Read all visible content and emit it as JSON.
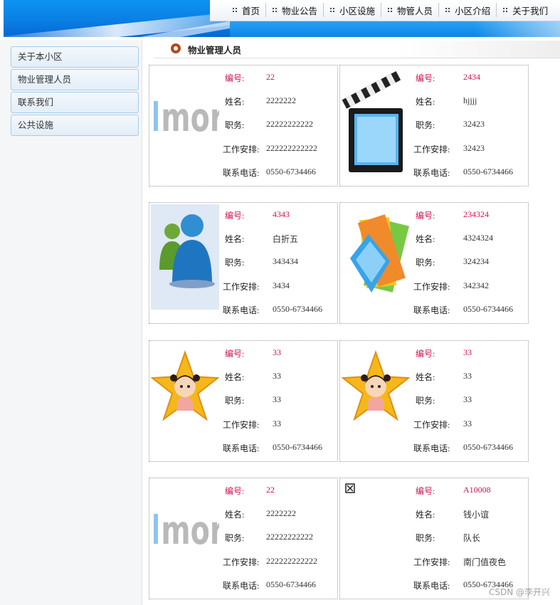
{
  "nav": [
    "首页",
    "物业公告",
    "小区设施",
    "物管人员",
    "小区介绍",
    "关于我们"
  ],
  "sidebar": [
    "关于本小区",
    "物业管理人员",
    "联系我们",
    "公共设施"
  ],
  "section_title": "物业管理人员",
  "labels": {
    "id": "编号:",
    "name": "姓名:",
    "position": "职务:",
    "schedule": "工作安排:",
    "phone": "联系电话:"
  },
  "staff": [
    {
      "image": "more-logo",
      "id": "22",
      "name": "2222222",
      "position": "22222222222",
      "schedule": "222222222222",
      "phone": "0550-6734466"
    },
    {
      "image": "clapperboard-icon",
      "id": "2434",
      "name": "hjjjj",
      "position": "32423",
      "schedule": "32423",
      "phone": "0550-6734466"
    },
    {
      "image": "messenger-users-icon",
      "id": "4343",
      "name": "白折五",
      "position": "343434",
      "schedule": "3434",
      "phone": "0550-6734466"
    },
    {
      "image": "photo-cards-icon",
      "id": "234324",
      "name": "4324324",
      "position": "324234",
      "schedule": "342342",
      "phone": "0550-6734466"
    },
    {
      "image": "star-girl-icon",
      "id": "33",
      "name": "33",
      "position": "33",
      "schedule": "33",
      "phone": "0550-6734466"
    },
    {
      "image": "star-girl-icon",
      "id": "33",
      "name": "33",
      "position": "33",
      "schedule": "33",
      "phone": "0550-6734466"
    },
    {
      "image": "more-logo",
      "id": "22",
      "name": "2222222",
      "position": "22222222222",
      "schedule": "222222222222",
      "phone": "0550-6734466"
    },
    {
      "image": "broken-image-icon",
      "id": "A10008",
      "name": "钱小谊",
      "position": "队长",
      "schedule": "南门值夜色",
      "phone": "0550-6734466"
    }
  ],
  "watermark": "CSDN @李开兴"
}
